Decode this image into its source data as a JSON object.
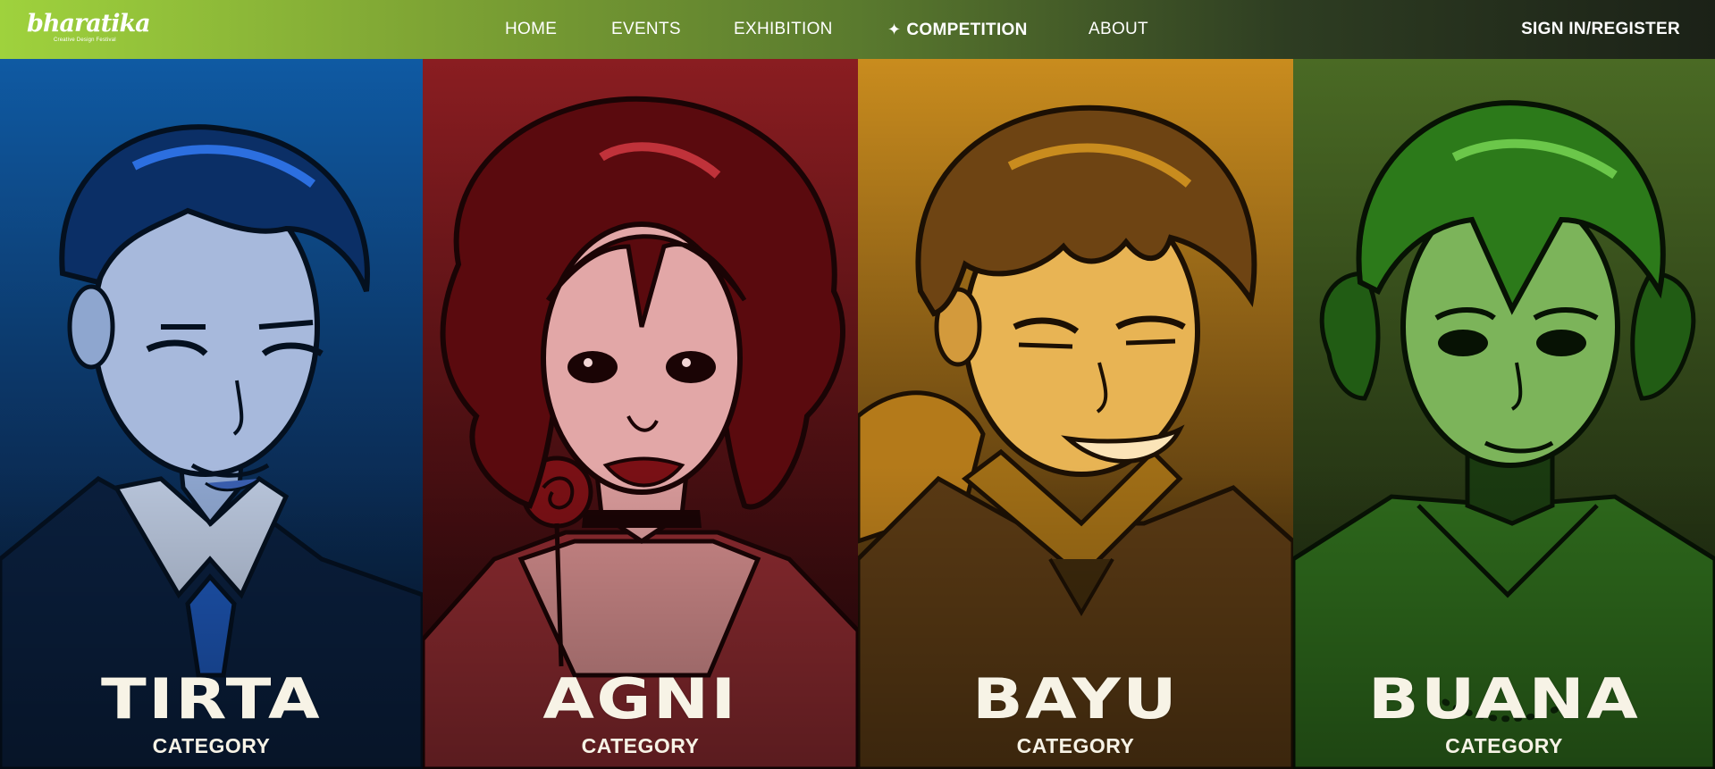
{
  "logo": {
    "text": "bharatika",
    "tagline": "Creative Design Festival"
  },
  "nav": {
    "items": [
      {
        "label": "HOME",
        "active": false
      },
      {
        "label": "EVENTS",
        "active": false
      },
      {
        "label": "EXHIBITION",
        "active": false
      },
      {
        "label": "COMPETITION",
        "active": true,
        "icon": "sparkle-icon"
      },
      {
        "label": "ABOUT",
        "active": false
      }
    ],
    "signin": "SIGN IN/REGISTER"
  },
  "panels": [
    {
      "name": "TIRTA",
      "subtitle": "CATEGORY",
      "color": "#0f5aa3"
    },
    {
      "name": "AGNI",
      "subtitle": "CATEGORY",
      "color": "#8a1d21"
    },
    {
      "name": "BAYU",
      "subtitle": "CATEGORY",
      "color": "#c98c1e"
    },
    {
      "name": "BUANA",
      "subtitle": "CATEGORY",
      "color": "#4a6a24"
    }
  ],
  "colors": {
    "nav_start": "#9fd23d",
    "nav_end": "#1b2117",
    "text_light": "#f7f3e6"
  }
}
